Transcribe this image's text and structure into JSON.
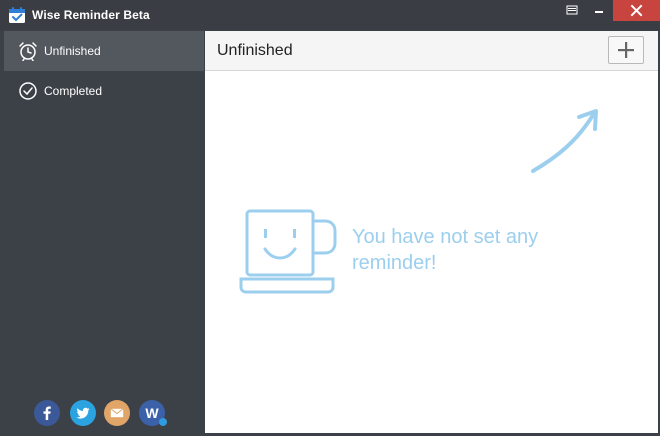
{
  "window": {
    "title": "Wise Reminder Beta",
    "app_icon": "calendar-check-icon",
    "controls": [
      "menu-icon",
      "minimize-icon",
      "close-icon"
    ]
  },
  "sidebar": {
    "items": [
      {
        "label": "Unfinished",
        "icon": "alarm-clock-icon",
        "active": true
      },
      {
        "label": "Completed",
        "icon": "check-circle-icon",
        "active": false
      }
    ],
    "social": [
      {
        "name": "facebook",
        "color": "#3b5998"
      },
      {
        "name": "twitter",
        "color": "#2aa3e0"
      },
      {
        "name": "email",
        "color": "#e0a567"
      },
      {
        "name": "wisecleaner",
        "color": "#3b62a8"
      }
    ]
  },
  "main": {
    "title": "Unfinished",
    "add_button_icon": "plus-icon",
    "empty_message": "You have not set any reminder!",
    "empty_icon": "smiling-cup-icon",
    "hint_icon": "arrow-up-right-icon"
  },
  "colors": {
    "sidebar_bg": "#3c4047",
    "active_item_bg": "#53575e",
    "close_button": "#c8453f",
    "empty_text": "#9ccfee"
  }
}
